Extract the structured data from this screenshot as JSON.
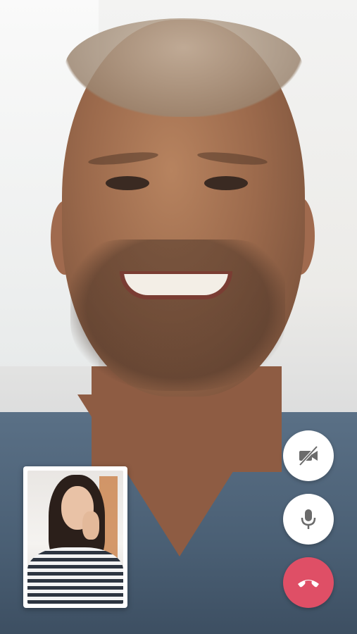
{
  "call": {
    "remote_video": "remote-participant-video",
    "self_view": "local-preview-video"
  },
  "controls": [
    {
      "name": "camera-off-button",
      "icon": "video-off-icon"
    },
    {
      "name": "mute-microphone-button",
      "icon": "microphone-icon"
    },
    {
      "name": "end-call-button",
      "icon": "phone-hangup-icon"
    }
  ],
  "colors": {
    "end_call": "#df4f66",
    "button_bg": "#ffffff",
    "icon": "#6b6b6b"
  }
}
